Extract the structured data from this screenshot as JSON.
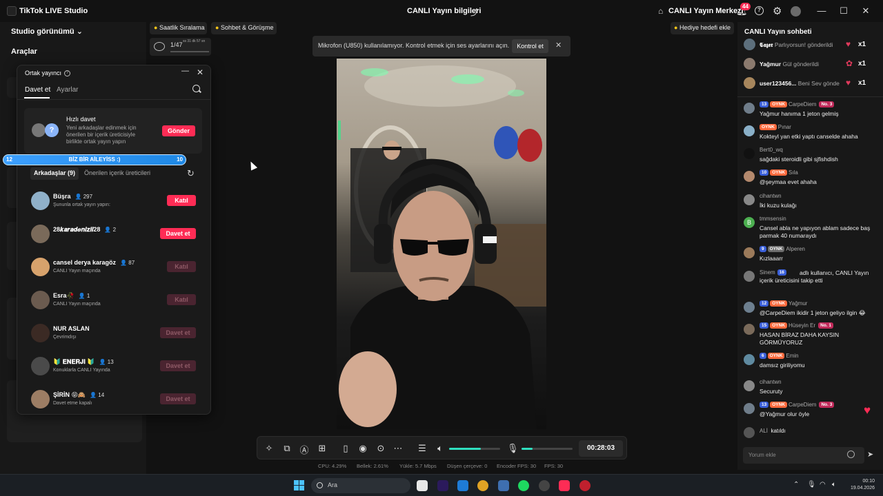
{
  "titlebar": {
    "app_name": "TikTok LIVE Studio",
    "center_title": "CANLI Yayın bilgileri",
    "live_center": "CANLI Yayın Merkezi",
    "notification_count": "44"
  },
  "left_panel": {
    "studio_view": "Studio görünümü",
    "tools_heading": "Araçlar"
  },
  "stage": {
    "chip_hourly": "Saatlik Sıralama",
    "chip_chat_call": "Sohbet & Görüşme",
    "mini_counter": "1/47",
    "mini_counter_sub": "ss 31 dk 57 sn",
    "gift_goal": "Hediye hedefi ekle"
  },
  "notice": {
    "text": "Mikrofon (U850) kullanılamıyor. Kontrol etmek için ses ayarlarını açın.",
    "button": "Kontrol et"
  },
  "cohost": {
    "title": "Ortak yayıncı",
    "tab_invite": "Davet et",
    "tab_settings": "Ayarlar",
    "quick_title": "Hızlı davet",
    "quick_desc": "Yeni arkadaşlar edinmek için önerilen bir içerik üreticisiyle birlikte ortak yayın yapın",
    "quick_button": "Gönder",
    "tab_friends": "Arkadaşlar (9)",
    "tab_suggested": "Önerilen içerik üreticileri",
    "friends": [
      {
        "name": "Büşra",
        "count": "297",
        "sub": "Şununla ortak yayın yapın:",
        "button": "Katıl"
      },
      {
        "name": "28𝒌𝒂𝒓𝒂𝒅𝒆𝒏𝒊𝒛𝒍𝒊28",
        "count": "2",
        "sub": "",
        "button": "Davet et"
      },
      {
        "name": "cansel derya karagöz",
        "count": "87",
        "sub": "CANLI Yayın maçında",
        "button": "Katıl"
      },
      {
        "name": "Esra🥀",
        "count": "1",
        "sub": "CANLI Yayın maçında",
        "button": "Katıl"
      },
      {
        "name": "NUR ASLAN",
        "count": "",
        "sub": "Çevrimdışı",
        "button": "Davet et"
      },
      {
        "name": "🔰 𝐄𝐍𝐄𝐑𝐉𝐈 🔰",
        "count": "13",
        "sub": "Konuklarla CANLI Yayında",
        "button": "Davet et"
      },
      {
        "name": "ŞİRİN 😝🙈",
        "count": "14",
        "sub": "Davet etme kapalı",
        "button": "Davet et"
      }
    ]
  },
  "banner": {
    "left": "12",
    "center": "BİZ BİR AİLEYİSS :)",
    "right": "10",
    "progress": 1.0
  },
  "controls": {
    "timer": "00:28:03",
    "speaker_level": 0.62,
    "mic_level": 0.22
  },
  "stats": {
    "cpu": "CPU:  4.29%",
    "memory": "Bellek:  2.61%",
    "upload": "Yükle:  5.7 Mbps",
    "dropped": "Düşen çerçeve:  0",
    "encoder_fps": "Encoder FPS:  30",
    "fps": "FPS:  30"
  },
  "chat": {
    "title": "CANLI Yayın sohbeti",
    "gifts": [
      {
        "user": "𝕮𝖆𝖟𝖊𝖗",
        "action": "Parlıyorsun! gönderildi",
        "mult": "x1"
      },
      {
        "user": "Yağmur",
        "action": "Gül gönderildi",
        "mult": "x1"
      },
      {
        "user": "user123456...",
        "action": "Beni Sev gönde",
        "mult": "x1"
      }
    ],
    "messages": [
      {
        "lvl": "13",
        "fan": "OYNK",
        "name": "CarpeDiem",
        "rank": "No. 3",
        "text": "Yağmur hanıma 1 jeton gelmiş"
      },
      {
        "lvl": "",
        "fan": "OYNK",
        "name": "Pınar",
        "rank": "",
        "text": "Kokteyl yan etki yaptı canselde ahaha"
      },
      {
        "lvl": "",
        "fan": "",
        "name": "Bert0_wq",
        "rank": "",
        "text": "sağdaki steroidli gibi sjfishdish"
      },
      {
        "lvl": "10",
        "fan": "OYNK",
        "name": "Sıla",
        "rank": "",
        "text": "@şeymaa evet ahaha"
      },
      {
        "lvl": "",
        "fan": "",
        "name": "cihantwn",
        "rank": "",
        "text": "İki kuzu kulağı"
      },
      {
        "lvl": "",
        "fan": "",
        "name": "tmmsensin",
        "rank": "",
        "text": "Cansel abla ne yapıyon ablam sadece baş parmak 40 numaraydı"
      },
      {
        "lvl": "9",
        "fan": "OYNK",
        "name": "Alperen",
        "rank": "",
        "text": "Kızlaaarr"
      },
      {
        "lvl": "",
        "fan": "",
        "name": "Sinem",
        "rank": "",
        "text": "adlı kullanıcı, CANLI Yayın içerik üreticisini takip etti",
        "follow_lvl": "16"
      },
      {
        "lvl": "12",
        "fan": "OYNK",
        "name": "Yağmur",
        "rank": "",
        "text": "@CarpeDiem ikidir 1 jeton geliyo ilgin 😂"
      },
      {
        "lvl": "15",
        "fan": "OYNK",
        "name": "Hüseyin Er",
        "rank": "No. 1",
        "text": "HASAN BİRAZ DAHA KAYSIN GÖRMÜYORUZ"
      },
      {
        "lvl": "6",
        "fan": "OYNK",
        "name": "Emin",
        "rank": "",
        "text": "damsız giriliyomu"
      },
      {
        "lvl": "",
        "fan": "",
        "name": "cihantwn",
        "rank": "",
        "text": "Securuty"
      },
      {
        "lvl": "13",
        "fan": "OYNK",
        "name": "CarpeDiem",
        "rank": "No. 3",
        "text": "@Yağmur olur öyle"
      }
    ],
    "join_name": "ALİ",
    "join_text": "katıldı",
    "input_placeholder": "Yorum ekle"
  },
  "taskbar": {
    "search": "Ara",
    "time": "00:10",
    "date": "19.04.2026"
  }
}
